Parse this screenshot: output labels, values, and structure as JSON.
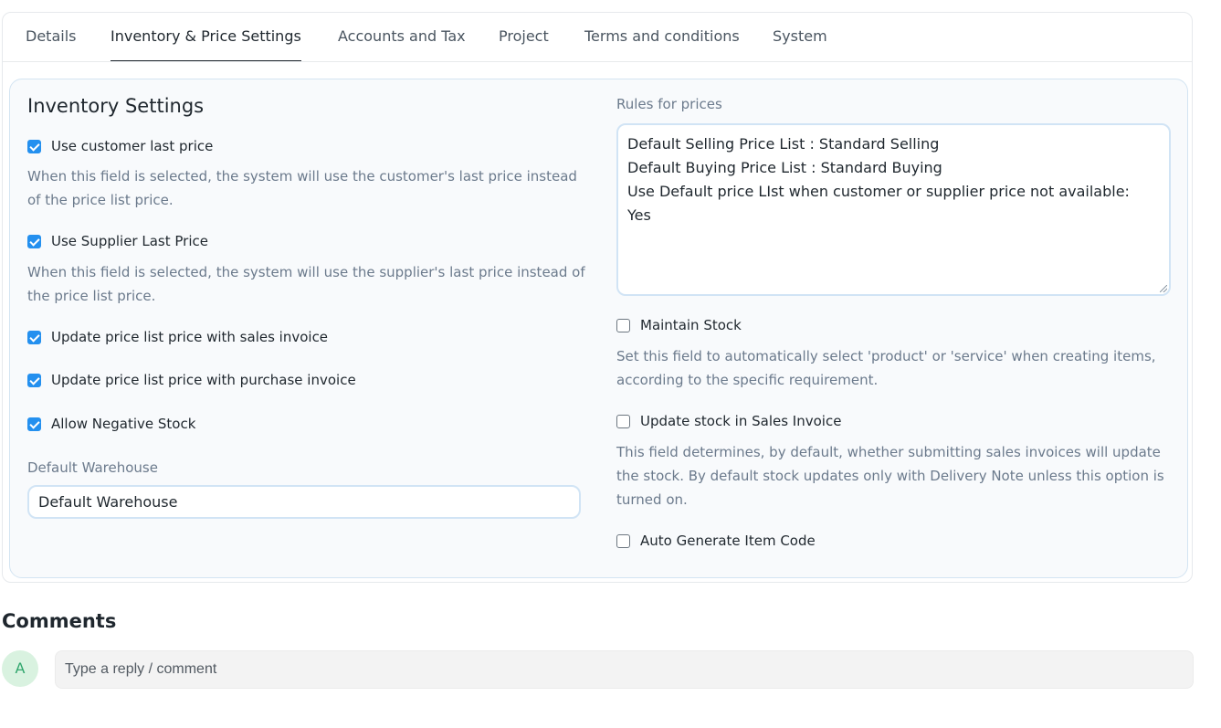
{
  "tabs": [
    {
      "label": "Details"
    },
    {
      "label": "Inventory & Price Settings",
      "active": true
    },
    {
      "label": "Accounts and Tax"
    },
    {
      "label": "Project"
    },
    {
      "label": "Terms and conditions"
    },
    {
      "label": "System"
    }
  ],
  "inventory": {
    "title": "Inventory Settings",
    "options": [
      {
        "label": "Use customer last price",
        "checked": true,
        "description": "When this field is selected, the system will use the customer's last price instead of the price list price."
      },
      {
        "label": "Use Supplier Last Price",
        "checked": true,
        "description": "When this field is selected, the system will use the supplier's last price instead of the price list price."
      },
      {
        "label": "Update price list price with sales invoice",
        "checked": true
      },
      {
        "label": "Update price list price with purchase invoice",
        "checked": true
      },
      {
        "label": "Allow Negative Stock",
        "checked": true
      }
    ],
    "default_warehouse_label": "Default Warehouse",
    "default_warehouse_value": "Default Warehouse"
  },
  "rules": {
    "label": "Rules for prices",
    "lines": [
      "Default Selling Price List : Standard Selling",
      "Default Buying Price List : Standard Buying",
      "Use Default price LIst when customer or supplier price not available:",
      "Yes"
    ]
  },
  "stock_options": [
    {
      "label": "Maintain Stock",
      "checked": false,
      "description": "Set this field to automatically select 'product' or 'service' when creating items, according to the specific requirement."
    },
    {
      "label": "Update stock in Sales Invoice",
      "checked": false,
      "description": "This field determines, by default, whether submitting sales invoices will update the stock. By default stock updates only with Delivery Note unless this option is turned on."
    },
    {
      "label": "Auto Generate Item Code",
      "checked": false
    }
  ],
  "comments": {
    "title": "Comments",
    "avatar_initial": "A",
    "placeholder": "Type a reply / comment"
  },
  "colors": {
    "accent": "#2490ef",
    "avatar_bg": "#d9f2e0",
    "avatar_fg": "#30a66d"
  }
}
